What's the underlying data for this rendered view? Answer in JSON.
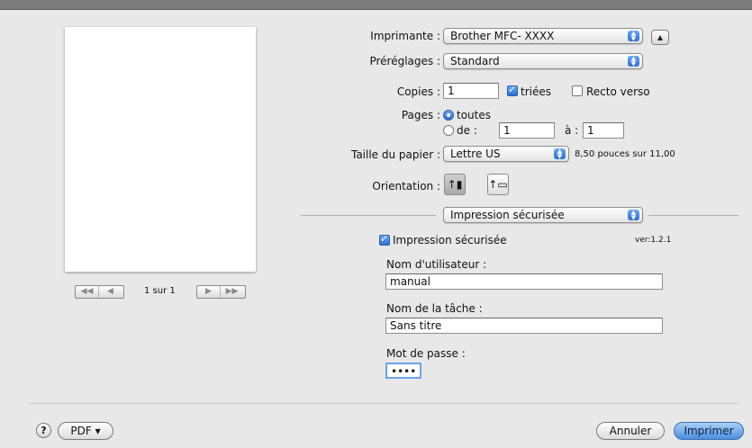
{
  "printer": {
    "label": "Imprimante :",
    "value": "Brother MFC- XXXX"
  },
  "presets": {
    "label": "Préréglages :",
    "value": "Standard"
  },
  "copies": {
    "label": "Copies :",
    "value": "1",
    "collated_label": "triées",
    "collated": true,
    "duplex_label": "Recto verso",
    "duplex": false
  },
  "pages": {
    "label": "Pages :",
    "all_label": "toutes",
    "range_label": "de :",
    "from": "1",
    "to_label": "à :",
    "to": "1",
    "selected": "all"
  },
  "paper": {
    "label": "Taille du papier :",
    "value": "Lettre US",
    "size_text": "8,50 pouces sur 11,00"
  },
  "orientation": {
    "label": "Orientation :",
    "options": [
      "portrait-icon",
      "landscape-icon"
    ],
    "selected": "portrait-icon"
  },
  "panel_select": {
    "value": "Impression sécurisée"
  },
  "secure": {
    "checkbox_label": "Impression sécurisée",
    "enabled": true,
    "version": "ver:1.2.1",
    "username_label": "Nom d'utilisateur :",
    "username": "manual",
    "jobname_label": "Nom de la tâche :",
    "jobname": "Sans titre",
    "password_label": "Mot de passe :",
    "password_masked": "••••"
  },
  "preview": {
    "page_counter": "1 sur 1",
    "nav_back": [
      "◀◀",
      "◀"
    ],
    "nav_forward": [
      "▶",
      "▶▶"
    ]
  },
  "footer": {
    "help": "?",
    "pdf": "PDF ▾",
    "cancel": "Annuler",
    "print": "Imprimer"
  },
  "colors": {
    "accent": "#3b82e0",
    "background": "#e8e8e8"
  }
}
